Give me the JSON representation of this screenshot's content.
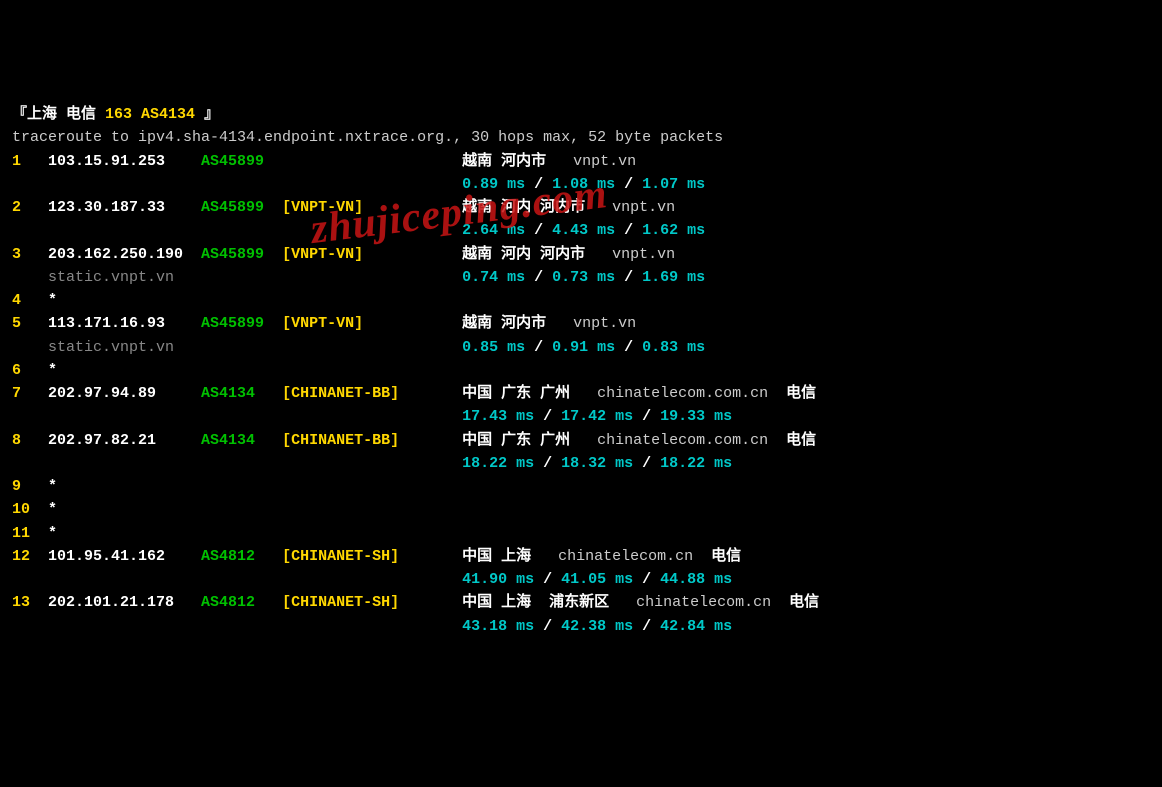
{
  "header": {
    "open": "『",
    "title1": "上海 电信",
    "title2": " 163 AS4134 ",
    "close": "』"
  },
  "cmdline": "traceroute to ipv4.sha-4134.endpoint.nxtrace.org., 30 hops max, 52 byte packets",
  "watermark": "zhujiceping.com",
  "hops": [
    {
      "n": "1",
      "ip": "103.15.91.253",
      "asn": "AS45899",
      "tag": "",
      "rdns": "",
      "loc": "越南 河内市",
      "domain": "vnpt.vn",
      "isp": "",
      "t1": "0.89 ms",
      "t2": "1.08 ms",
      "t3": "1.07 ms"
    },
    {
      "n": "2",
      "ip": "123.30.187.33",
      "asn": "AS45899",
      "tag": "[VNPT-VN]",
      "rdns": "",
      "loc": "越南 河内 河内市",
      "domain": "vnpt.vn",
      "isp": "",
      "t1": "2.64 ms",
      "t2": "4.43 ms",
      "t3": "1.62 ms"
    },
    {
      "n": "3",
      "ip": "203.162.250.190",
      "asn": "AS45899",
      "tag": "[VNPT-VN]",
      "rdns": "static.vnpt.vn",
      "loc": "越南 河内 河内市",
      "domain": "vnpt.vn",
      "isp": "",
      "t1": "0.74 ms",
      "t2": "0.73 ms",
      "t3": "1.69 ms"
    },
    {
      "n": "4",
      "ip": "*",
      "asn": "",
      "tag": "",
      "rdns": "",
      "loc": "",
      "domain": "",
      "isp": "",
      "t1": "",
      "t2": "",
      "t3": ""
    },
    {
      "n": "5",
      "ip": "113.171.16.93",
      "asn": "AS45899",
      "tag": "[VNPT-VN]",
      "rdns": "static.vnpt.vn",
      "loc": "越南 河内市",
      "domain": "vnpt.vn",
      "isp": "",
      "t1": "0.85 ms",
      "t2": "0.91 ms",
      "t3": "0.83 ms"
    },
    {
      "n": "6",
      "ip": "*",
      "asn": "",
      "tag": "",
      "rdns": "",
      "loc": "",
      "domain": "",
      "isp": "",
      "t1": "",
      "t2": "",
      "t3": ""
    },
    {
      "n": "7",
      "ip": "202.97.94.89",
      "asn": "AS4134",
      "tag": "[CHINANET-BB]",
      "rdns": "",
      "loc": "中国 广东 广州",
      "domain": "chinatelecom.com.cn",
      "isp": "电信",
      "t1": "17.43 ms",
      "t2": "17.42 ms",
      "t3": "19.33 ms"
    },
    {
      "n": "8",
      "ip": "202.97.82.21",
      "asn": "AS4134",
      "tag": "[CHINANET-BB]",
      "rdns": "",
      "loc": "中国 广东 广州",
      "domain": "chinatelecom.com.cn",
      "isp": "电信",
      "t1": "18.22 ms",
      "t2": "18.32 ms",
      "t3": "18.22 ms"
    },
    {
      "n": "9",
      "ip": "*",
      "asn": "",
      "tag": "",
      "rdns": "",
      "loc": "",
      "domain": "",
      "isp": "",
      "t1": "",
      "t2": "",
      "t3": ""
    },
    {
      "n": "10",
      "ip": "*",
      "asn": "",
      "tag": "",
      "rdns": "",
      "loc": "",
      "domain": "",
      "isp": "",
      "t1": "",
      "t2": "",
      "t3": ""
    },
    {
      "n": "11",
      "ip": "*",
      "asn": "",
      "tag": "",
      "rdns": "",
      "loc": "",
      "domain": "",
      "isp": "",
      "t1": "",
      "t2": "",
      "t3": ""
    },
    {
      "n": "12",
      "ip": "101.95.41.162",
      "asn": "AS4812",
      "tag": "[CHINANET-SH]",
      "rdns": "",
      "loc": "中国 上海",
      "domain": "chinatelecom.cn",
      "isp": "电信",
      "t1": "41.90 ms",
      "t2": "41.05 ms",
      "t3": "44.88 ms"
    },
    {
      "n": "13",
      "ip": "202.101.21.178",
      "asn": "AS4812",
      "tag": "[CHINANET-SH]",
      "rdns": "",
      "loc": "中国 上海  浦东新区",
      "domain": "chinatelecom.cn",
      "isp": "电信",
      "t1": "43.18 ms",
      "t2": "42.38 ms",
      "t3": "42.84 ms"
    }
  ],
  "sep": " / "
}
